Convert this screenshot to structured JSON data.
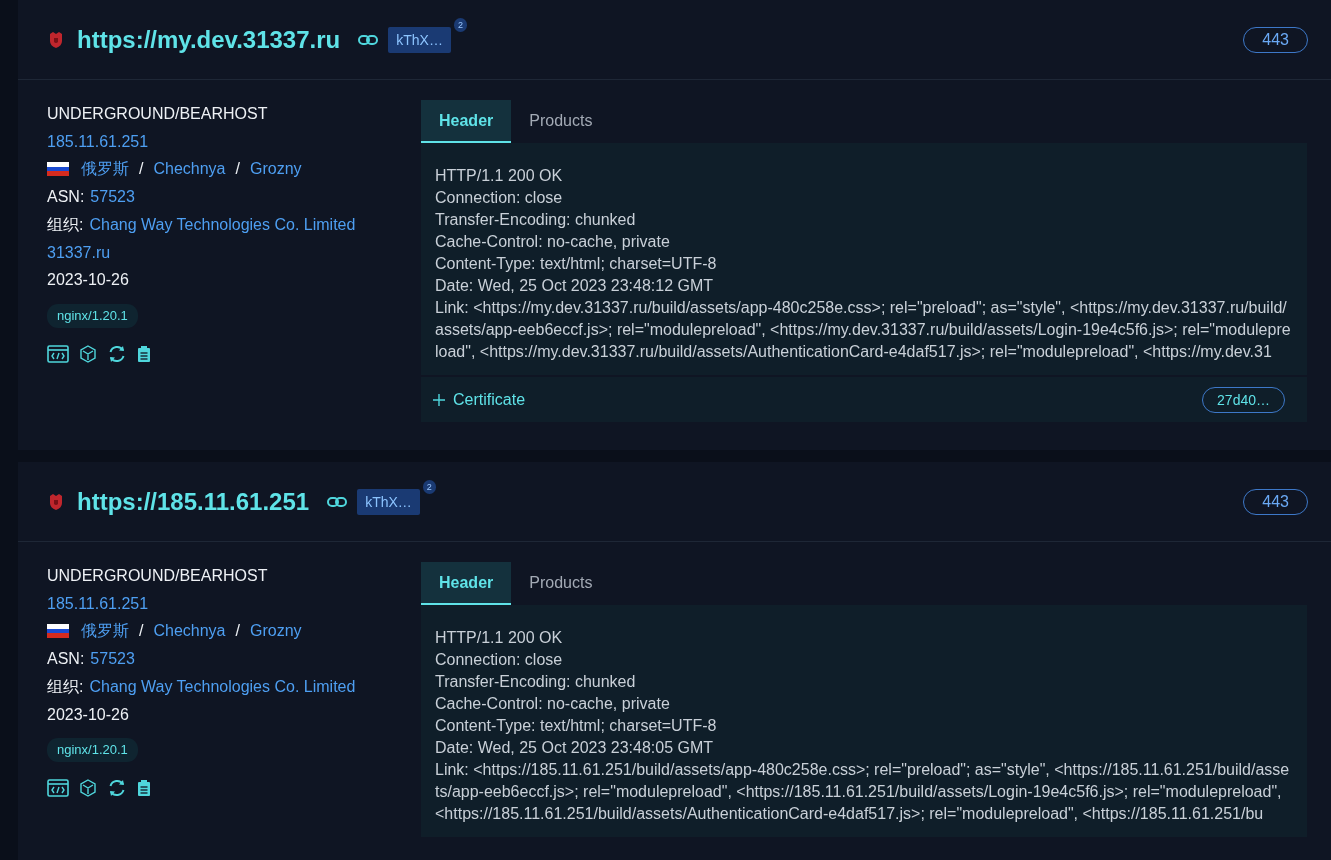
{
  "cards": [
    {
      "url": "https://my.dev.31337.ru",
      "separators": [
        "/",
        "/"
      ],
      "tag": "kThX…",
      "tag_count": "2",
      "port": "443",
      "org": "UNDERGROUND/BEARHOST",
      "ip": "185.11.61.251",
      "country": "俄罗斯",
      "region": "Chechnya",
      "city": "Grozny",
      "asn_label": "ASN:",
      "asn": "57523",
      "company_label": "组织:",
      "company": "Chang Way Technologies Co. Limited",
      "domain": "31337.ru",
      "date": "2023-10-26",
      "server": "nginx/1.20.1",
      "tabs": [
        {
          "label": "Header",
          "selected": true
        },
        {
          "label": "Products",
          "selected": false
        }
      ],
      "header_lines": [
        "HTTP/1.1 200 OK",
        "Connection: close",
        "Transfer-Encoding: chunked",
        "Cache-Control: no-cache, private",
        "Content-Type: text/html; charset=UTF-8",
        "Date: Wed, 25 Oct 2023 23:48:12 GMT",
        "Link: <https://my.dev.31337.ru/build/assets/app-480c258e.css>; rel=\"preload\"; as=\"style\", <https://my.dev.31337.ru/build/assets/app-eeb6eccf.js>; rel=\"modulepreload\", <https://my.dev.31337.ru/build/assets/Login-19e4c5f6.js>; rel=\"modulepreload\", <https://my.dev.31337.ru/build/assets/AuthenticationCard-e4daf517.js>; rel=\"modulepreload\", <https://my.dev.31"
      ],
      "certificate": {
        "label": "Certificate",
        "hash": "27d40…"
      }
    },
    {
      "url": "https://185.11.61.251",
      "separators": [
        "/",
        "/"
      ],
      "tag": "kThX…",
      "tag_count": "2",
      "port": "443",
      "org": "UNDERGROUND/BEARHOST",
      "ip": "185.11.61.251",
      "country": "俄罗斯",
      "region": "Chechnya",
      "city": "Grozny",
      "asn_label": "ASN:",
      "asn": "57523",
      "company_label": "组织:",
      "company": "Chang Way Technologies Co. Limited",
      "date": "2023-10-26",
      "server": "nginx/1.20.1",
      "tabs": [
        {
          "label": "Header",
          "selected": true
        },
        {
          "label": "Products",
          "selected": false
        }
      ],
      "header_lines": [
        "HTTP/1.1 200 OK",
        "Connection: close",
        "Transfer-Encoding: chunked",
        "Cache-Control: no-cache, private",
        "Content-Type: text/html; charset=UTF-8",
        "Date: Wed, 25 Oct 2023 23:48:05 GMT",
        "Link: <https://185.11.61.251/build/assets/app-480c258e.css>; rel=\"preload\"; as=\"style\", <https://185.11.61.251/build/assets/app-eeb6eccf.js>; rel=\"modulepreload\", <https://185.11.61.251/build/assets/Login-19e4c5f6.js>; rel=\"modulepreload\", <https://185.11.61.251/build/assets/AuthenticationCard-e4daf517.js>; rel=\"modulepreload\", <https://185.11.61.251/bu"
      ]
    }
  ]
}
